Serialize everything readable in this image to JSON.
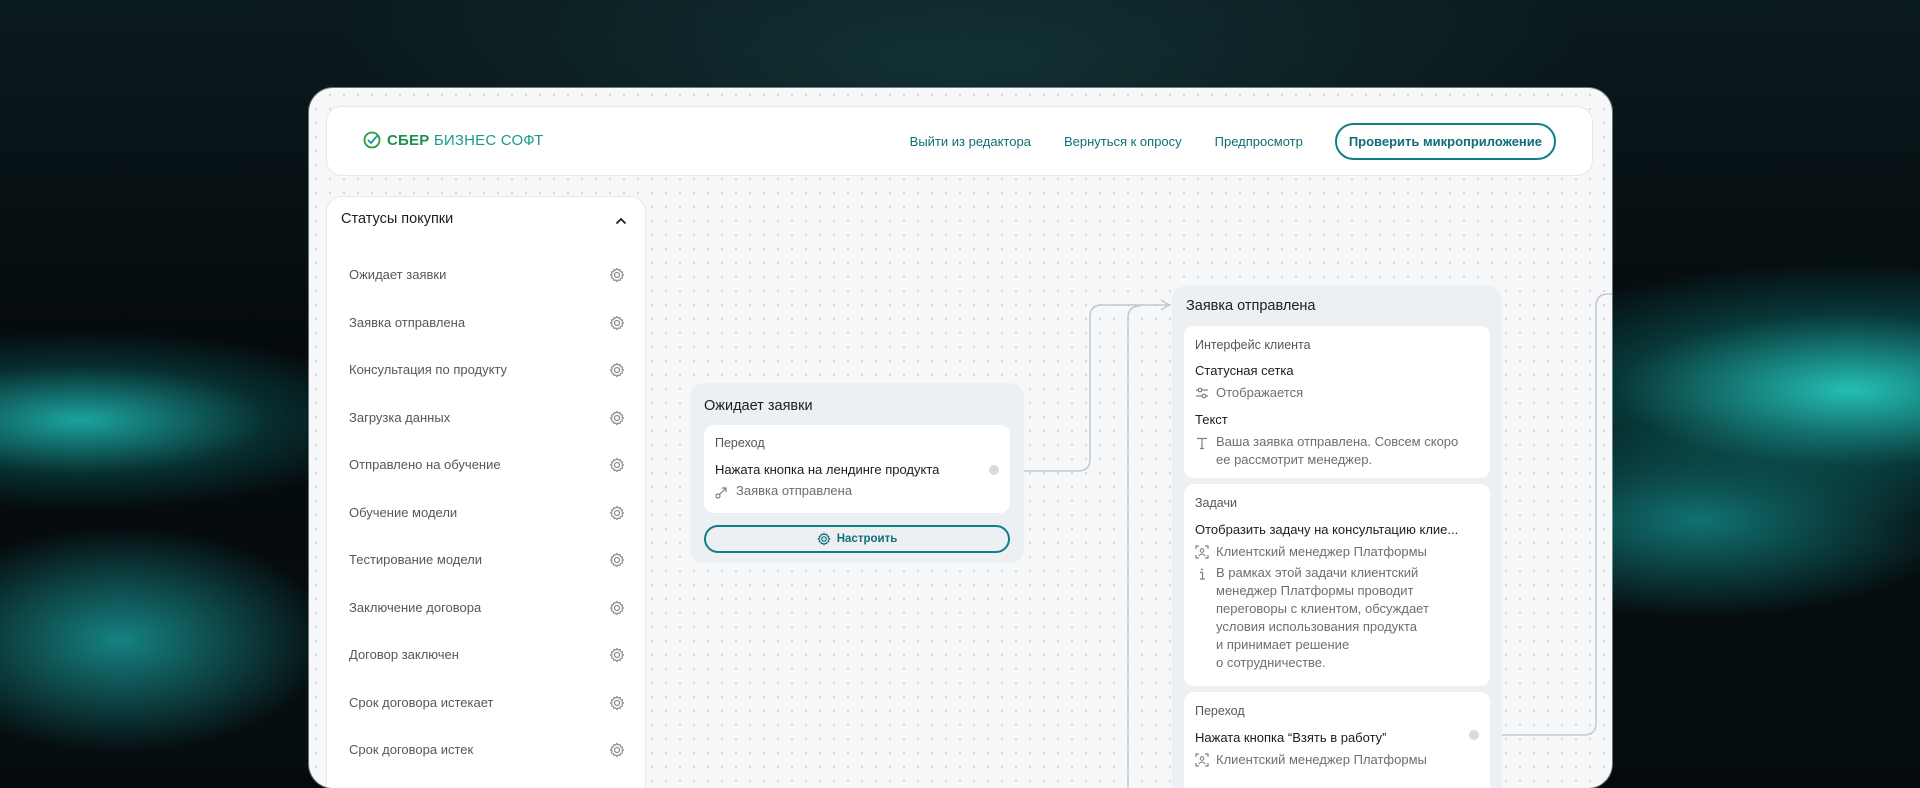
{
  "brand": {
    "bold": "СБЕР",
    "light": "БИЗНЕС СОФТ",
    "color": "#21a038"
  },
  "nav": {
    "exit_editor": "Выйти из редактора",
    "back_to_survey": "Вернуться к опросу",
    "preview": "Предпросмотр",
    "check_app": "Проверить микроприложение"
  },
  "sidebar": {
    "title": "Статусы покупки",
    "items": [
      "Ожидает заявки",
      "Заявка отправлена",
      "Консультация по продукту",
      "Загрузка данных",
      "Отправлено на обучение",
      "Обучение модели",
      "Тестирование модели",
      "Заключение договора",
      "Договор заключен",
      "Срок договора истекает",
      "Срок договора истек"
    ]
  },
  "node_waiting": {
    "title": "Ожидает заявки",
    "section": "Переход",
    "trigger": "Нажата кнопка на лендинге продукта",
    "target": "Заявка отправлена",
    "configure": "Настроить"
  },
  "node_sent": {
    "title": "Заявка отправлена",
    "interface": {
      "section": "Интерфейс клиента",
      "grid_label": "Статусная сетка",
      "grid_value": "Отображается",
      "text_label": "Текст",
      "text_value_1": "Ваша заявка отправлена. Совсем скоро",
      "text_value_2": "ее рассмотрит менеджер."
    },
    "tasks": {
      "section": "Задачи",
      "task": "Отобразить задачу на консультацию клие...",
      "assignee": "Клиентский менеджер Платформы",
      "desc_1": "В рамках этой задачи клиентский",
      "desc_2": "менеджер Платформы проводит",
      "desc_3": "переговоры с клиентом, обсуждает",
      "desc_4": "условия использования продукта",
      "desc_5": "и принимает решение",
      "desc_6": "о сотрудничестве."
    },
    "transition": {
      "section": "Переход",
      "trigger": "Нажата кнопка “Взять в работу”",
      "assignee": "Клиентский менеджер Платформы"
    }
  },
  "colors": {
    "accent": "#0f7f87",
    "panel": "#f6f7f8",
    "node": "#edf0f2"
  }
}
